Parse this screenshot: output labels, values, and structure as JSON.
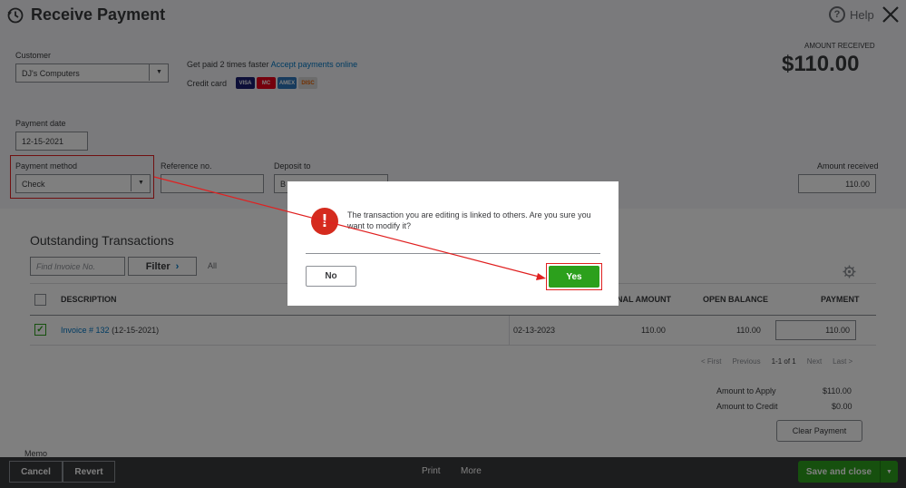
{
  "header": {
    "title": "Receive Payment",
    "help_label": "Help"
  },
  "customer": {
    "label": "Customer",
    "value": "DJ's Computers"
  },
  "promo": {
    "text": "Get paid 2 times faster",
    "link": "Accept payments online",
    "credit_card_label": "Credit card",
    "cards": [
      "VISA",
      "MC",
      "AMEX",
      "DISC"
    ]
  },
  "amount_received": {
    "label": "AMOUNT RECEIVED",
    "value": "$110.00",
    "field_label": "Amount received",
    "field_value": "110.00"
  },
  "payment_date": {
    "label": "Payment date",
    "value": "12-15-2021"
  },
  "payment_method": {
    "label": "Payment method",
    "value": "Check"
  },
  "reference": {
    "label": "Reference no.",
    "value": ""
  },
  "deposit_to": {
    "label": "Deposit to",
    "value": "B"
  },
  "outstanding": {
    "title": "Outstanding Transactions",
    "find_placeholder": "Find Invoice No.",
    "filter_label": "Filter",
    "all_label": "All",
    "columns": [
      "DESCRIPTION",
      "NAL AMOUNT",
      "OPEN BALANCE",
      "PAYMENT"
    ],
    "rows": [
      {
        "invoice_link": "Invoice # 132",
        "invoice_date": "(12-15-2021)",
        "due_date": "02-13-2023",
        "original": "110.00",
        "open_balance": "110.00",
        "payment": "110.00"
      }
    ]
  },
  "pager": {
    "first": "< First",
    "previous": "Previous",
    "range": "1-1 of 1",
    "next": "Next",
    "last": "Last >"
  },
  "totals": {
    "apply_label": "Amount to Apply",
    "apply_value": "$110.00",
    "credit_label": "Amount to Credit",
    "credit_value": "$0.00"
  },
  "clear_payment_label": "Clear Payment",
  "memo_label": "Memo",
  "footer": {
    "cancel": "Cancel",
    "revert": "Revert",
    "print": "Print",
    "more": "More",
    "save_close": "Save and close"
  },
  "dialog": {
    "message": "The transaction you are editing is linked to others. Are you sure you want to modify it?",
    "no": "No",
    "yes": "Yes"
  },
  "colors": {
    "brand_green": "#2ca01c",
    "link_blue": "#0077c5",
    "alert_red": "#d52b1e",
    "highlight_red": "#e02020"
  }
}
